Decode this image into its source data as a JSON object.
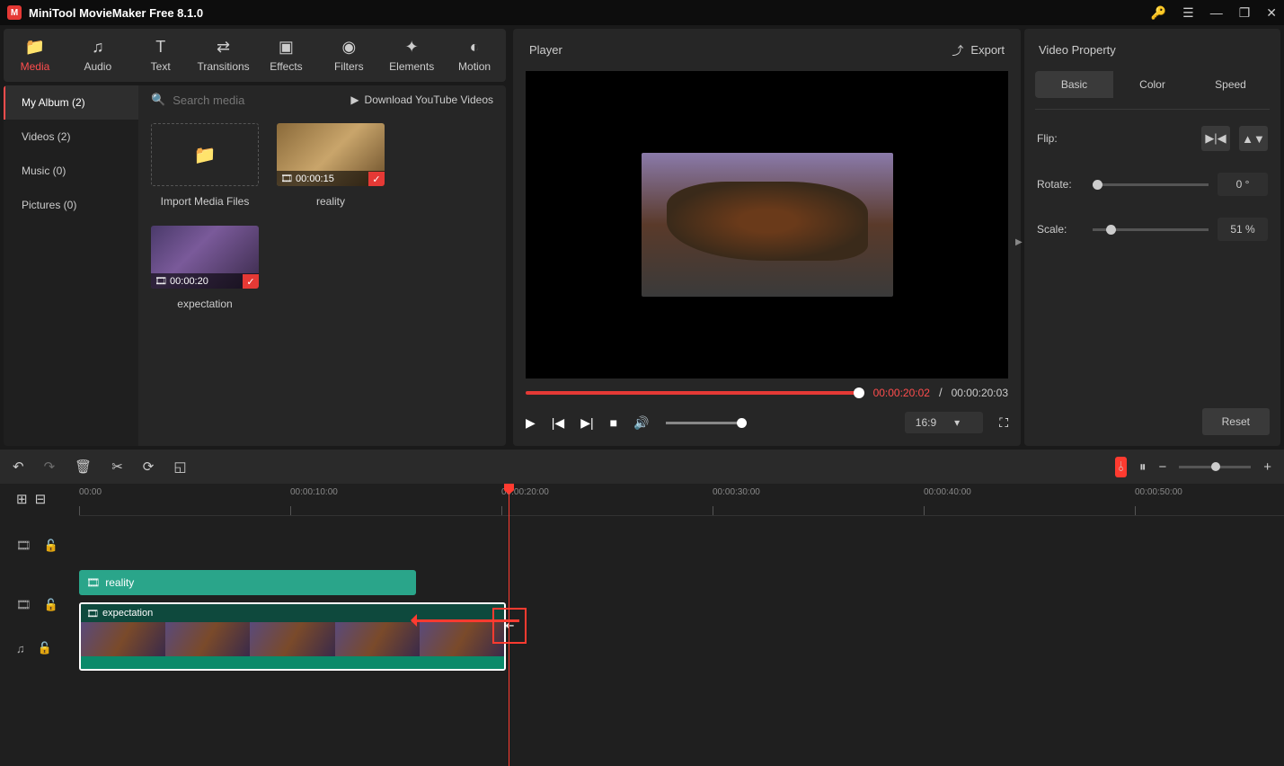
{
  "title": "MiniTool MovieMaker Free 8.1.0",
  "toolbar": [
    {
      "label": "Media",
      "active": true
    },
    {
      "label": "Audio"
    },
    {
      "label": "Text"
    },
    {
      "label": "Transitions"
    },
    {
      "label": "Effects"
    },
    {
      "label": "Filters"
    },
    {
      "label": "Elements"
    },
    {
      "label": "Motion"
    }
  ],
  "media_sidebar": [
    {
      "label": "My Album (2)",
      "active": true
    },
    {
      "label": "Videos (2)"
    },
    {
      "label": "Music (0)"
    },
    {
      "label": "Pictures (0)"
    }
  ],
  "search_placeholder": "Search media",
  "download_link": "Download YouTube Videos",
  "import_label": "Import Media Files",
  "clips": [
    {
      "name": "reality",
      "duration": "00:00:15"
    },
    {
      "name": "expectation",
      "duration": "00:00:20"
    }
  ],
  "player": {
    "title": "Player",
    "export": "Export",
    "current": "00:00:20:02",
    "total": "00:00:20:03",
    "aspect": "16:9"
  },
  "property": {
    "title": "Video Property",
    "tabs": [
      "Basic",
      "Color",
      "Speed"
    ],
    "flip_label": "Flip:",
    "rotate_label": "Rotate:",
    "rotate_value": "0 °",
    "scale_label": "Scale:",
    "scale_value": "51 %",
    "reset": "Reset"
  },
  "ruler": [
    "00:00",
    "00:00:10:00",
    "00:00:20:00",
    "00:00:30:00",
    "00:00:40:00",
    "00:00:50:00"
  ],
  "timeline_clips": {
    "reality": "reality",
    "expectation": "expectation"
  }
}
